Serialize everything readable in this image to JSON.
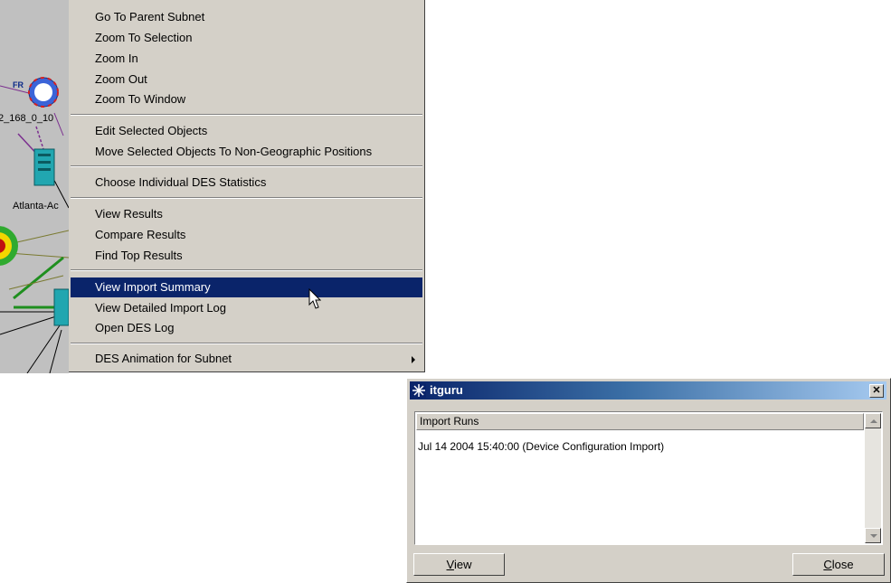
{
  "canvas": {
    "labels": [
      "2_168_0_10",
      "Atlanta-Ac"
    ],
    "fr_badge": "FR"
  },
  "context_menu": {
    "groups": [
      [
        "Go To Parent Subnet",
        "Zoom To Selection",
        "Zoom In",
        "Zoom Out",
        "Zoom To Window"
      ],
      [
        "Edit Selected Objects",
        "Move Selected Objects To Non-Geographic Positions"
      ],
      [
        "Choose Individual DES Statistics"
      ],
      [
        "View Results",
        "Compare Results",
        "Find Top Results"
      ],
      [
        "View Import Summary",
        "View Detailed Import Log",
        "Open DES Log"
      ],
      [
        "DES Animation for Subnet"
      ]
    ],
    "selected": "View Import Summary",
    "submenu_item": "DES Animation for Subnet"
  },
  "dialog": {
    "title": "itguru",
    "list_header": "Import Runs",
    "rows": [
      "Jul 14 2004 15:40:00 (Device Configuration Import)"
    ],
    "view_button": {
      "pre": "",
      "mnemonic": "V",
      "post": "iew"
    },
    "close_button": {
      "pre": "",
      "mnemonic": "C",
      "post": "lose"
    }
  },
  "colors": {
    "menu_bg": "#d4d0c8",
    "selection": "#0a246a",
    "canvas_bg": "#c0c0c0"
  }
}
